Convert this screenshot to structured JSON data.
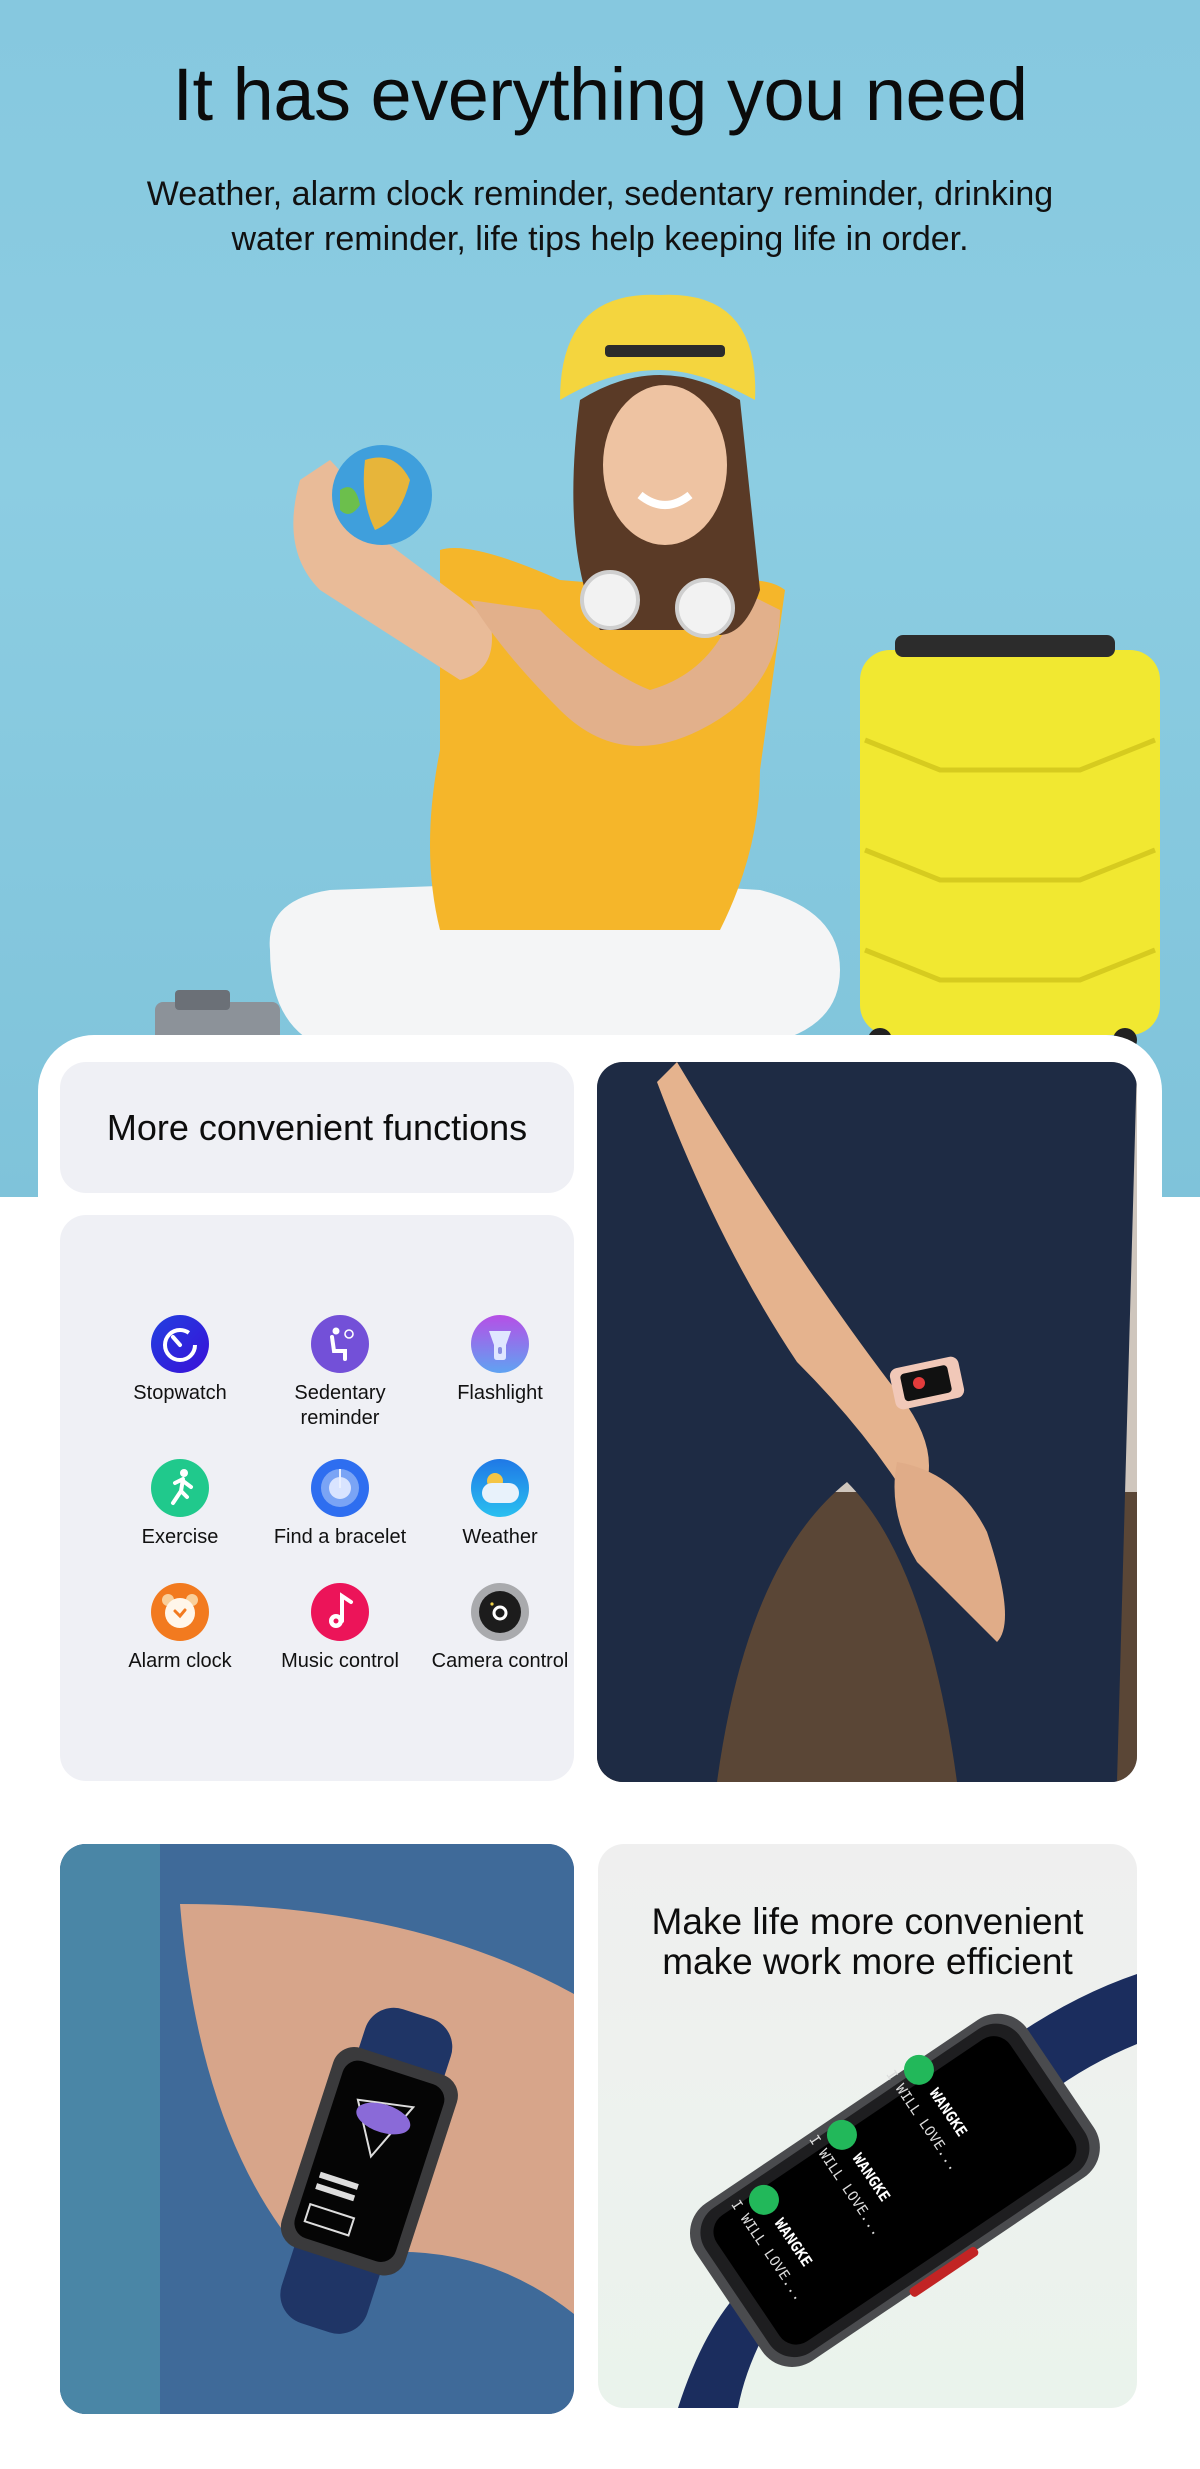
{
  "hero": {
    "title": "It has everything you need",
    "subtitle_line1": "Weather, alarm clock reminder, sedentary reminder, drinking",
    "subtitle_line2": "water reminder, life tips help keeping life in order.",
    "background_color": "#8ccde2"
  },
  "functions": {
    "title": "More convenient functions",
    "items": [
      {
        "label": "Stopwatch",
        "icon": "stopwatch-icon"
      },
      {
        "label": "Sedentary reminder",
        "icon": "sedentary-reminder-icon"
      },
      {
        "label": "Flashlight",
        "icon": "flashlight-icon"
      },
      {
        "label": "Exercise",
        "icon": "exercise-icon"
      },
      {
        "label": "Find a bracelet",
        "icon": "find-bracelet-icon"
      },
      {
        "label": "Weather",
        "icon": "weather-icon"
      },
      {
        "label": "Alarm clock",
        "icon": "alarm-clock-icon"
      },
      {
        "label": "Music control",
        "icon": "music-control-icon"
      },
      {
        "label": "Camera control",
        "icon": "camera-control-icon"
      }
    ]
  },
  "watch_section": {
    "title_line1": "Make life more convenient",
    "title_line2": "make work more efficient",
    "notifications": [
      {
        "sender": "WANGKE",
        "message": "I WILL LOVE..."
      },
      {
        "sender": "WANGKE",
        "message": "I WILL LOVE..."
      },
      {
        "sender": "WANGKE",
        "message": "I WILL LOVE..."
      }
    ]
  }
}
